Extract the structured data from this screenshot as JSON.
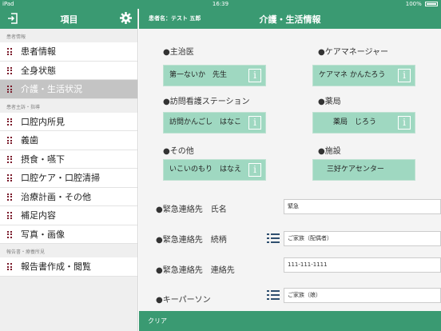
{
  "status_bar": {
    "device": "iPad",
    "time": "16:39",
    "battery": "100%"
  },
  "sidebar": {
    "title": "項目",
    "sections": [
      {
        "label": "患者情報",
        "items": [
          "患者情報",
          "全身状態",
          "介護・生活状況"
        ]
      },
      {
        "label": "患者主訴・指導",
        "items": [
          "口腔内所見",
          "義歯",
          "摂食・嚥下",
          "口腔ケア・口腔清掃",
          "治療計画・その他",
          "補足内容",
          "写真・画像"
        ]
      },
      {
        "label": "報告書・療養所見",
        "items": [
          "報告書作成・閲覧"
        ]
      }
    ],
    "selected": "介護・生活状況"
  },
  "main": {
    "patient_label": "患者名：テスト 五郎",
    "title": "介護・生活情報",
    "contacts": [
      {
        "label": "●主治医",
        "value": "第一ないか　先生",
        "info": true
      },
      {
        "label": "●ケアマネージャー",
        "value": "ケアマネ かんたろう",
        "info": true
      },
      {
        "label": "●訪問看護ステーション",
        "value": "訪問かんごし　はなこ",
        "info": true
      },
      {
        "label": "●薬局",
        "value": "薬局　じろう",
        "info": true
      },
      {
        "label": "●その他",
        "value": "いこいのもり　はなえ",
        "info": true
      },
      {
        "label": "●施設",
        "value": "三好ケアセンター",
        "info": false
      }
    ],
    "info_glyph": "i",
    "form": [
      {
        "label": "●緊急連絡先　氏名",
        "value": "緊急",
        "list": false
      },
      {
        "label": "●緊急連絡先　続柄",
        "value": "ご家族（配偶者）",
        "list": true
      },
      {
        "label": "●緊急連絡先　連絡先",
        "value": "111-111-1111",
        "list": false
      },
      {
        "label": "●キーパーソン",
        "value": "ご家族（娘）",
        "list": true
      }
    ],
    "footer_label": "クリア"
  },
  "colors": {
    "accent": "#3a9a72",
    "card": "#9fd8c1",
    "selected": "#c4c4c4",
    "grip": "#7a1a2a"
  }
}
